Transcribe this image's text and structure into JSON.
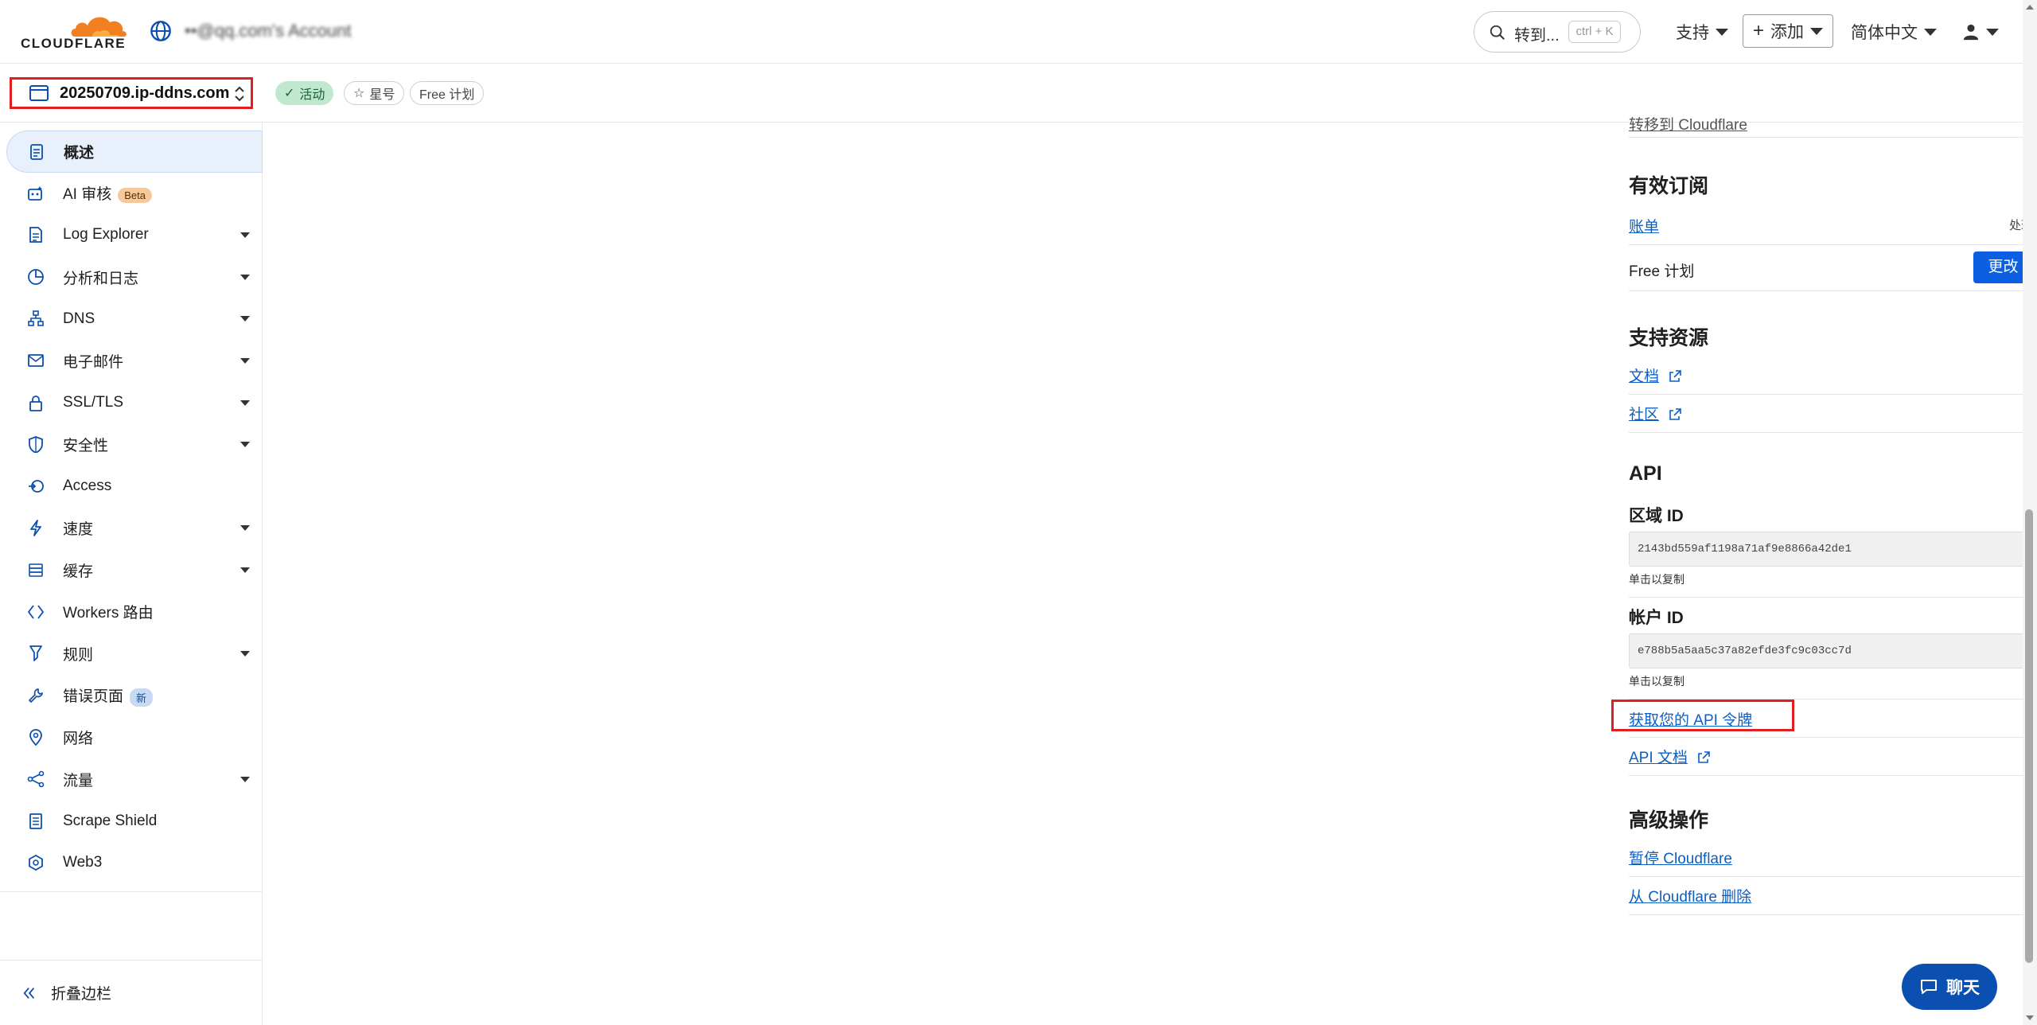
{
  "brand": {
    "name": "CLOUDFLARE",
    "accent": "#f38020"
  },
  "account": {
    "name": "••@qq.com's Account"
  },
  "header": {
    "search_placeholder": "转到...",
    "search_shortcut": "ctrl + K",
    "support_label": "支持",
    "add_label": "添加",
    "language_label": "简体中文"
  },
  "zone": {
    "name": "20250709.ip-ddns.com",
    "status_label": "活动",
    "star_label": "星号",
    "plan_label": "Free 计划"
  },
  "sidebar": {
    "items": [
      {
        "label": "概述",
        "icon": "overview-icon",
        "active": true
      },
      {
        "label": "AI 审核",
        "icon": "ai-audit-icon",
        "badge": "Beta"
      },
      {
        "label": "Log Explorer",
        "icon": "log-icon",
        "expandable": true
      },
      {
        "label": "分析和日志",
        "icon": "analytics-icon",
        "expandable": true
      },
      {
        "label": "DNS",
        "icon": "dns-icon",
        "expandable": true
      },
      {
        "label": "电子邮件",
        "icon": "email-icon",
        "expandable": true
      },
      {
        "label": "SSL/TLS",
        "icon": "lock-icon",
        "expandable": true
      },
      {
        "label": "安全性",
        "icon": "shield-icon",
        "expandable": true
      },
      {
        "label": "Access",
        "icon": "access-icon"
      },
      {
        "label": "速度",
        "icon": "lightning-icon",
        "expandable": true
      },
      {
        "label": "缓存",
        "icon": "cache-icon",
        "expandable": true
      },
      {
        "label": "Workers 路由",
        "icon": "workers-icon"
      },
      {
        "label": "规则",
        "icon": "rules-icon",
        "expandable": true
      },
      {
        "label": "错误页面",
        "icon": "wrench-icon",
        "badge": "新"
      },
      {
        "label": "网络",
        "icon": "location-pin-icon"
      },
      {
        "label": "流量",
        "icon": "traffic-icon",
        "expandable": true
      },
      {
        "label": "Scrape Shield",
        "icon": "document-icon"
      },
      {
        "label": "Web3",
        "icon": "web3-icon"
      }
    ],
    "collapse_label": "折叠边栏"
  },
  "right_panel": {
    "cut_off_link": "转移到 Cloudflare",
    "subscription": {
      "heading": "有效订阅",
      "billing_link": "账单",
      "billing_action": "处理",
      "plan_name": "Free 计划",
      "change_button": "更改"
    },
    "support": {
      "heading": "支持资源",
      "docs_link": "文档",
      "community_link": "社区"
    },
    "api": {
      "heading": "API",
      "zone_id_label": "区域 ID",
      "zone_id_value": "2143bd559af1198a71af9e8866a42de1",
      "click_to_copy": "单击以复制",
      "account_id_label": "帐户 ID",
      "account_id_value": "e788b5a5aa5c37a82efde3fc9c03cc7d",
      "get_token_link": "获取您的 API 令牌",
      "api_docs_link": "API 文档"
    },
    "advanced": {
      "heading": "高级操作",
      "pause_link": "暂停 Cloudflare",
      "remove_link": "从 Cloudflare 删除"
    }
  },
  "chat": {
    "label": "聊天"
  }
}
